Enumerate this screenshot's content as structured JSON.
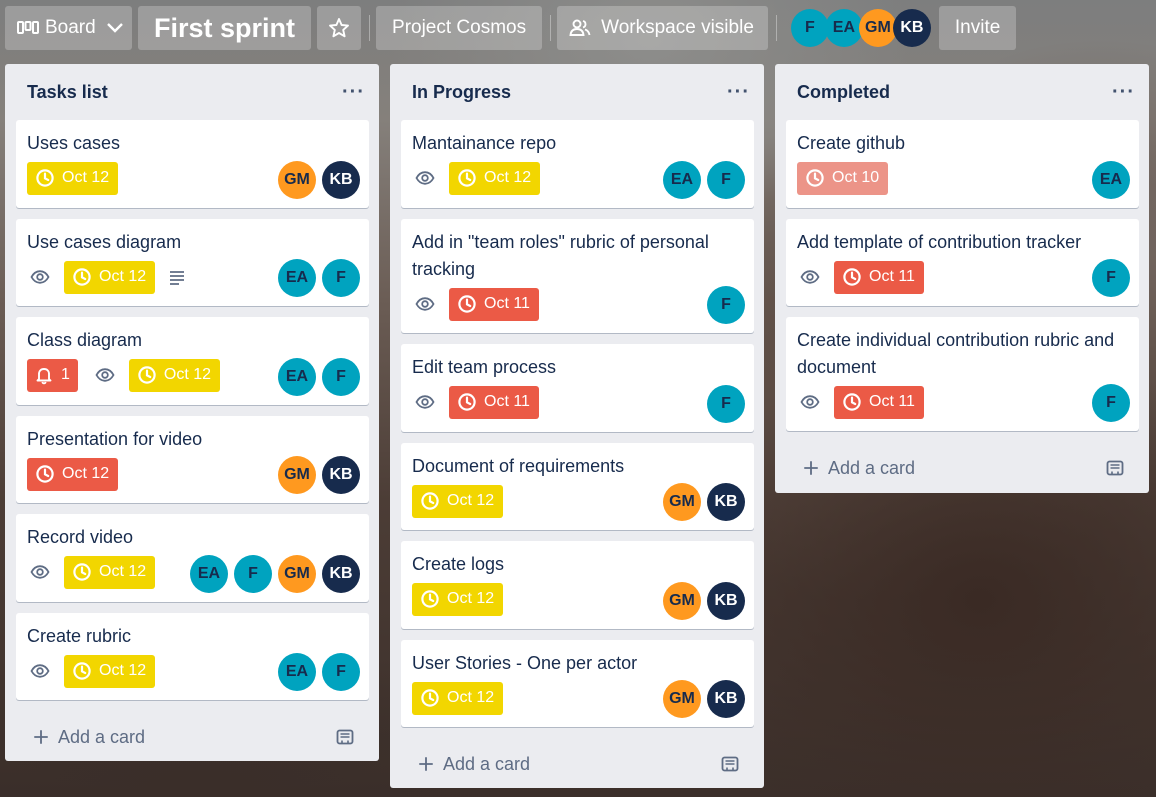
{
  "topbar": {
    "board_switch": "Board",
    "board_title": "First sprint",
    "team": "Project Cosmos",
    "visibility": "Workspace visible",
    "members": [
      {
        "initials": "F",
        "color": "#00a3bf"
      },
      {
        "initials": "EA",
        "color": "#00a3bf"
      },
      {
        "initials": "GM",
        "color": "#ff991f"
      },
      {
        "initials": "KB",
        "color": "#172b4d"
      }
    ],
    "invite": "Invite"
  },
  "lists": [
    {
      "title": "Tasks list",
      "add_card": "Add a card",
      "cards": [
        {
          "title": "Uses cases",
          "due": "Oct 12"
        },
        {
          "title": "Use cases diagram",
          "due": "Oct 12"
        },
        {
          "title": "Class diagram",
          "notifications": "1",
          "due": "Oct 12"
        },
        {
          "title": "Presentation for video",
          "due": "Oct 12"
        },
        {
          "title": "Record video",
          "due": "Oct 12"
        },
        {
          "title": "Create rubric",
          "due": "Oct 12"
        }
      ]
    },
    {
      "title": "In Progress",
      "add_card": "Add a card",
      "cards": [
        {
          "title": "Mantainance repo",
          "due": "Oct 12"
        },
        {
          "title": "Add in \"team roles\" rubric of personal tracking",
          "due": "Oct 11"
        },
        {
          "title": "Edit team process",
          "due": "Oct 11"
        },
        {
          "title": "Document of requirements",
          "due": "Oct 12"
        },
        {
          "title": "Create logs",
          "due": "Oct 12"
        },
        {
          "title": "User Stories - One per actor",
          "due": "Oct 12"
        }
      ]
    },
    {
      "title": "Completed",
      "add_card": "Add a card",
      "cards": [
        {
          "title": "Create github",
          "due": "Oct 10"
        },
        {
          "title": "Add template of contribution tracker",
          "due": "Oct 11"
        },
        {
          "title": "Create individual contribution rubric and document",
          "due": "Oct 11"
        }
      ]
    }
  ],
  "avatars": {
    "ea": "EA",
    "f": "F",
    "gm": "GM",
    "kb": "KB"
  },
  "colors": {
    "due_yellow": "#f2d600",
    "due_red": "#eb5a46",
    "due_overdue_light": "#ec9488",
    "avatar_teal": "#00a3bf",
    "avatar_orange": "#ff991f",
    "avatar_navy": "#172b4d"
  },
  "icons": [
    "board-icon",
    "chevron-down-icon",
    "star-icon",
    "workspace-icon",
    "clock-icon",
    "eye-icon",
    "description-icon",
    "bell-icon",
    "plus-icon",
    "template-icon",
    "more-icon"
  ]
}
